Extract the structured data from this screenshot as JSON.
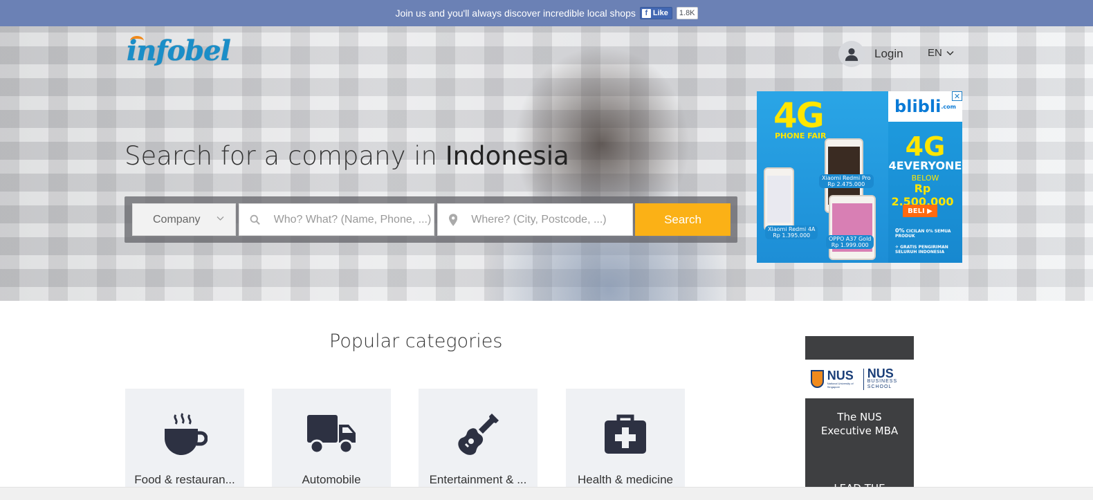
{
  "topbar": {
    "message": "Join us and you'll always discover incredible local shops",
    "fb_like_label": "Like",
    "fb_like_count": "1.8K"
  },
  "header": {
    "logo_text": "infobel",
    "login_label": "Login",
    "language": "EN"
  },
  "hero": {
    "title_prefix": "Search for a company in",
    "title_country": "Indonesia",
    "search": {
      "type_selected": "Company",
      "who_placeholder": "Who? What? (Name, Phone, ...)",
      "where_placeholder": "Where? (City, Postcode, ...)",
      "button_label": "Search"
    }
  },
  "ad_banner": {
    "headline": "4G",
    "subheadline": "PHONE FAIR",
    "brand": "blibli",
    "brand_suffix": ".com",
    "right_big": "4G",
    "right_tag": "4EVERYONE",
    "below_label": "BELOW",
    "price": "Rp 2.500.000",
    "cta": "BELI",
    "fine1": "CICILAN 0% SEMUA PRODUK",
    "fine2": "GRATIS PENGIRIMAN SELURUH INDONESIA",
    "zero_badge": "0%",
    "phones": [
      {
        "name": "Xiaomi Redmi Pro",
        "price": "Rp 2.475.000"
      },
      {
        "name": "Xiaomi Redmi 4A",
        "price": "Rp 1.395.000"
      },
      {
        "name": "OPPO A37 Gold",
        "price": "Rp 1.999.000"
      }
    ],
    "close_label": "✕"
  },
  "main": {
    "popular_title": "Popular categories",
    "categories": [
      {
        "label": "Food & restauran...",
        "icon": "coffee-cup-icon"
      },
      {
        "label": "Automobile",
        "icon": "truck-icon"
      },
      {
        "label": "Entertainment & ...",
        "icon": "guitar-icon"
      },
      {
        "label": "Health & medicine",
        "icon": "medical-kit-icon"
      }
    ]
  },
  "side_ad": {
    "nus_label": "NUS",
    "nus_sub": "National University of Singapore",
    "nbs_label": "NUS",
    "nbs_sub": "BUSINESS SCHOOL",
    "line1": "The NUS",
    "line2": "Executive MBA",
    "line3": "LEAD THE"
  },
  "colors": {
    "topbar": "#6b81b5",
    "accent": "#fbb116",
    "logo": "#1a8ec8",
    "icon": "#2d3142"
  }
}
